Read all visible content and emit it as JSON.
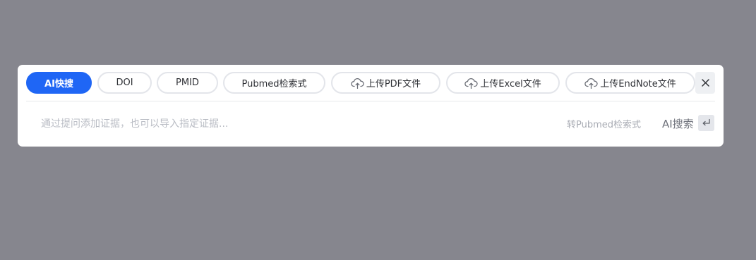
{
  "chips": [
    {
      "label": "AI快搜",
      "active": true
    },
    {
      "label": "DOI"
    },
    {
      "label": "PMID"
    },
    {
      "label": "Pubmed检索式"
    },
    {
      "label": "上传PDF文件",
      "icon": "cloud-upload-icon"
    },
    {
      "label": "上传Excel文件",
      "icon": "cloud-upload-icon"
    },
    {
      "label": "上传EndNote文件",
      "icon": "cloud-upload-icon"
    }
  ],
  "close_icon": "close-icon",
  "search": {
    "placeholder": "通过提问添加证据，也可以导入指定证据...",
    "value": ""
  },
  "convert_link": "转Pubmed检索式",
  "ai_search_label": "AI搜索",
  "enter_icon": "enter-key-icon",
  "colors": {
    "accent": "#1f66f5",
    "backdrop": "#86868e"
  }
}
